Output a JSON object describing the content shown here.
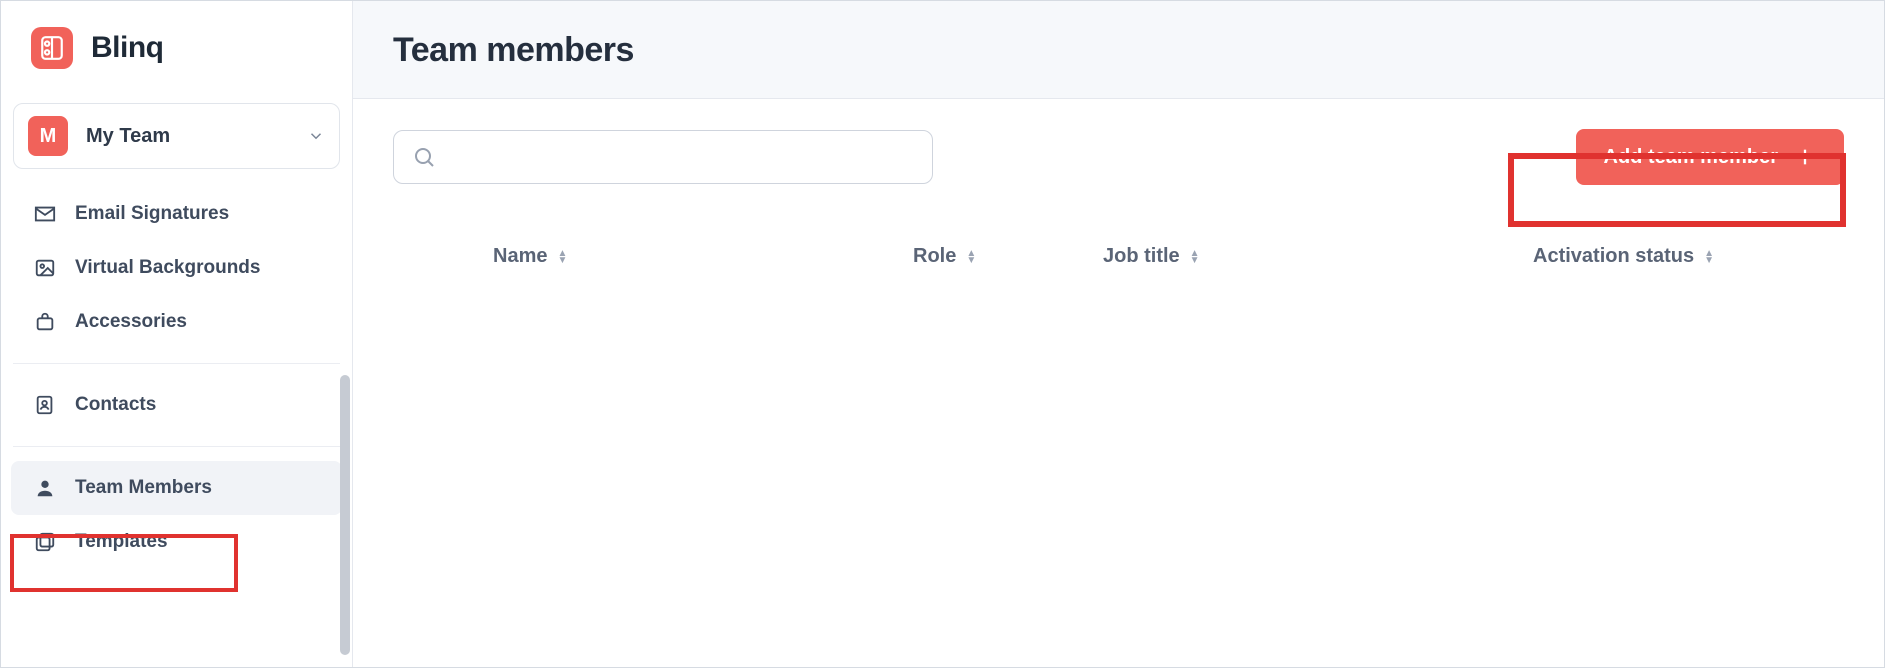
{
  "brand": {
    "name": "Blinq"
  },
  "team_selector": {
    "avatar_letter": "M",
    "name": "My Team"
  },
  "sidebar": {
    "items": [
      {
        "icon": "mail",
        "label": "Email Signatures"
      },
      {
        "icon": "image",
        "label": "Virtual Backgrounds"
      },
      {
        "icon": "bag",
        "label": "Accessories"
      },
      {
        "icon": "contacts",
        "label": "Contacts"
      },
      {
        "icon": "user",
        "label": "Team Members",
        "active": true
      },
      {
        "icon": "templates",
        "label": "Templates"
      }
    ]
  },
  "header": {
    "title": "Team members"
  },
  "toolbar": {
    "search_placeholder": "",
    "add_button_label": "Add team member"
  },
  "table": {
    "columns": [
      {
        "label": "Name"
      },
      {
        "label": "Role"
      },
      {
        "label": "Job title"
      },
      {
        "label": "Activation status"
      }
    ],
    "rows": []
  }
}
